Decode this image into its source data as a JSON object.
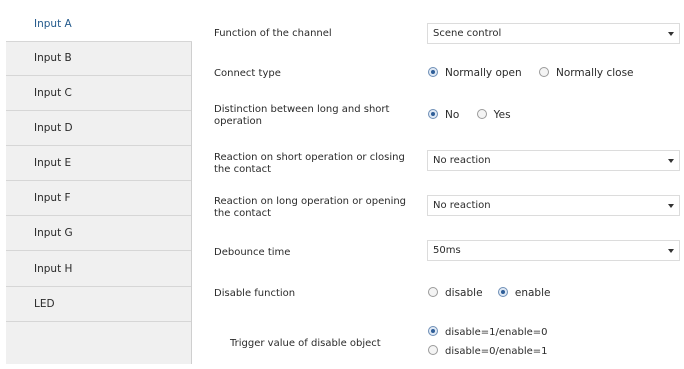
{
  "sidebar": {
    "items": [
      {
        "label": "Input A"
      },
      {
        "label": "Input B"
      },
      {
        "label": "Input C"
      },
      {
        "label": "Input D"
      },
      {
        "label": "Input E"
      },
      {
        "label": "Input F"
      },
      {
        "label": "Input G"
      },
      {
        "label": "Input H"
      },
      {
        "label": "LED"
      }
    ],
    "selected": "Input A"
  },
  "settings": {
    "function": {
      "label": "Function of the channel",
      "value": "Scene control"
    },
    "connect_type": {
      "label": "Connect type",
      "options": [
        "Normally open",
        "Normally close"
      ],
      "selected": "Normally open"
    },
    "distinction": {
      "label": "Distinction between long and short operation",
      "options": [
        "No",
        "Yes"
      ],
      "selected": "No"
    },
    "short_reaction": {
      "label": "Reaction on short operation or closing the contact",
      "value": "No reaction"
    },
    "long_reaction": {
      "label": "Reaction on long operation or opening the contact",
      "value": "No reaction"
    },
    "debounce": {
      "label": "Debounce time",
      "value": "50ms"
    },
    "disable_function": {
      "label": "Disable function",
      "options": [
        "disable",
        "enable"
      ],
      "selected": "enable"
    },
    "trigger_value": {
      "label": "Trigger value of disable object",
      "options": [
        "disable=1/enable=0",
        "disable=0/enable=1"
      ],
      "selected": "disable=1/enable=0"
    }
  }
}
